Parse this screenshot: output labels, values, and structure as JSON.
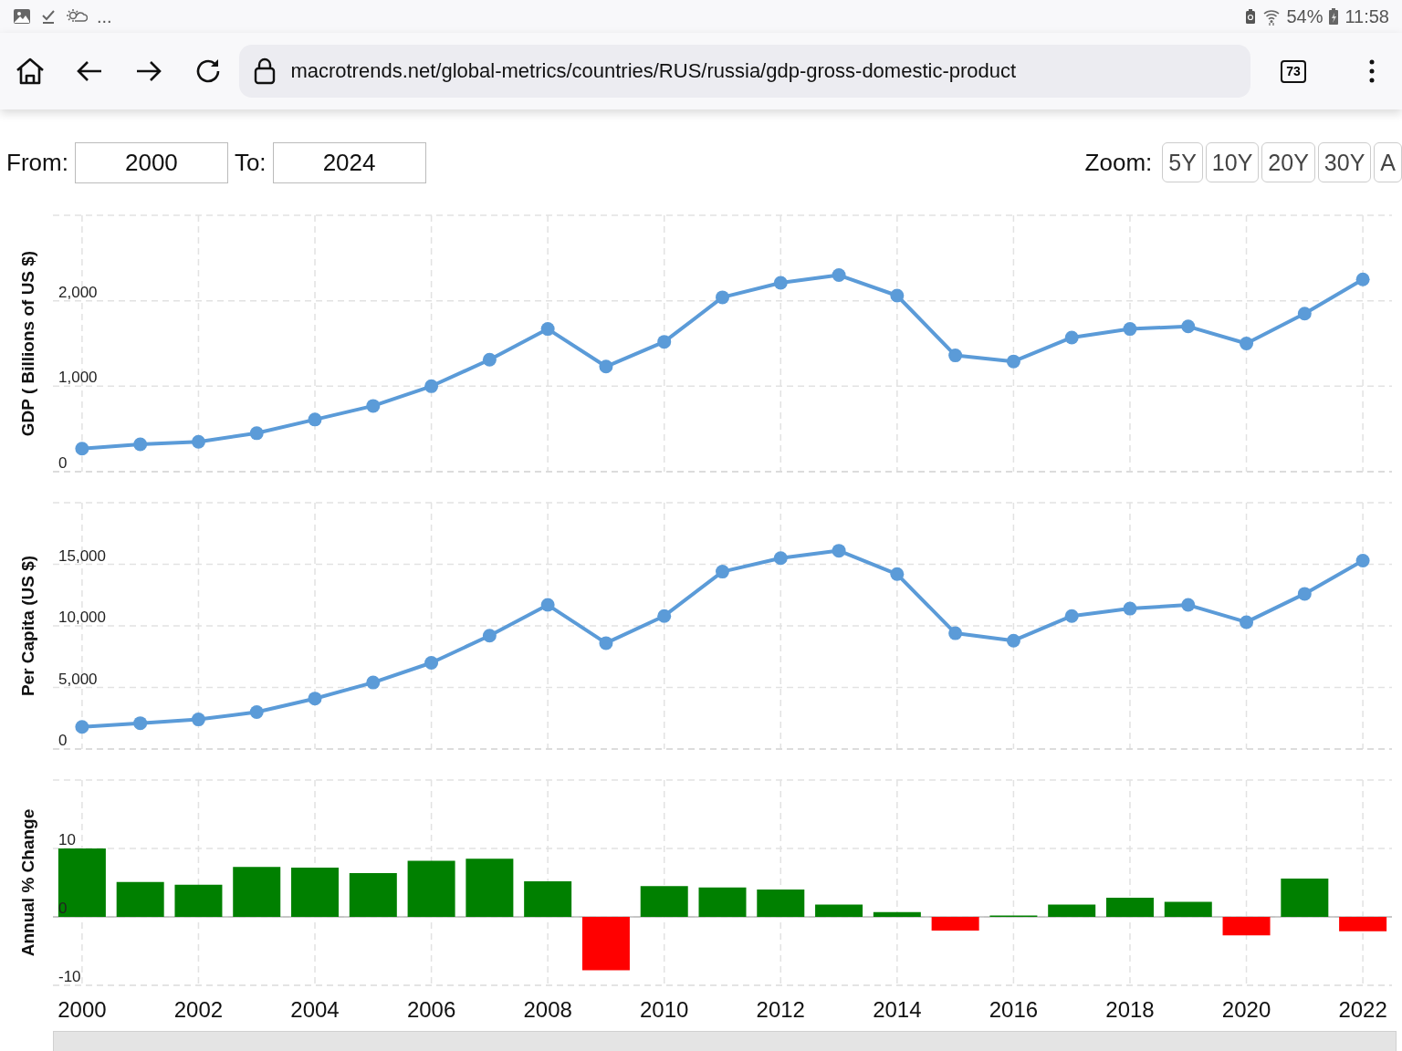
{
  "status_bar": {
    "more": "...",
    "battery": "54%",
    "time": "11:58"
  },
  "browser": {
    "url": "macrotrends.net/global-metrics/countries/RUS/russia/gdp-gross-domestic-product",
    "tab_count": "73"
  },
  "range": {
    "from_label": "From:",
    "from": "2000",
    "to_label": "To:",
    "to": "2024",
    "zoom_label": "Zoom:",
    "zoom_buttons": [
      "5Y",
      "10Y",
      "20Y",
      "30Y",
      "A"
    ]
  },
  "charts": [
    {
      "chart_data": {
        "type": "line",
        "ylabel": "GDP ( Billions of US $)",
        "grid": true,
        "x": [
          2000,
          2001,
          2002,
          2003,
          2004,
          2005,
          2006,
          2007,
          2008,
          2009,
          2010,
          2011,
          2012,
          2013,
          2014,
          2015,
          2016,
          2017,
          2018,
          2019,
          2020,
          2021,
          2022
        ],
        "series": [
          {
            "color": "#5b9bd8",
            "marker": "circle",
            "values": [
              270,
              320,
              350,
              450,
              610,
              770,
              1000,
              1310,
              1670,
              1230,
              1520,
              2040,
              2210,
              2300,
              2060,
              1360,
              1290,
              1570,
              1670,
              1700,
              1500,
              1850,
              2250
            ]
          }
        ],
        "xlim": [
          1999.5,
          2022.5
        ],
        "ylim": [
          0,
          3000
        ],
        "yticks": [
          {
            "value": 0,
            "label": "0"
          },
          {
            "value": 1000,
            "label": "1,000"
          },
          {
            "value": 2000,
            "label": "2,000"
          }
        ]
      }
    },
    {
      "chart_data": {
        "type": "line",
        "ylabel": "Per Capita (US $)",
        "grid": true,
        "x": [
          2000,
          2001,
          2002,
          2003,
          2004,
          2005,
          2006,
          2007,
          2008,
          2009,
          2010,
          2011,
          2012,
          2013,
          2014,
          2015,
          2016,
          2017,
          2018,
          2019,
          2020,
          2021,
          2022
        ],
        "series": [
          {
            "color": "#5b9bd8",
            "marker": "circle",
            "values": [
              1800,
              2100,
              2400,
              3000,
              4100,
              5400,
              7000,
              9200,
              11700,
              8600,
              10800,
              14400,
              15500,
              16100,
              14200,
              9400,
              8800,
              10800,
              11400,
              11700,
              10300,
              12600,
              15300
            ]
          }
        ],
        "xlim": [
          1999.5,
          2022.5
        ],
        "ylim": [
          0,
          20000
        ],
        "yticks": [
          {
            "value": 0,
            "label": "0"
          },
          {
            "value": 5000,
            "label": "5,000"
          },
          {
            "value": 10000,
            "label": "10,000"
          },
          {
            "value": 15000,
            "label": "15,000"
          }
        ]
      }
    },
    {
      "chart_data": {
        "type": "bar",
        "ylabel": "Annual % Change",
        "grid": true,
        "x": [
          2000,
          2001,
          2002,
          2003,
          2004,
          2005,
          2006,
          2007,
          2008,
          2009,
          2010,
          2011,
          2012,
          2013,
          2014,
          2015,
          2016,
          2017,
          2018,
          2019,
          2020,
          2021,
          2022
        ],
        "series": [
          {
            "color": "#008000",
            "values": [
              10.0,
              5.1,
              4.7,
              7.3,
              7.2,
              6.4,
              8.2,
              8.5,
              5.2,
              null,
              4.5,
              4.3,
              4.0,
              1.8,
              0.7,
              null,
              0.2,
              1.8,
              2.8,
              2.2,
              null,
              5.6,
              null
            ]
          },
          {
            "color": "#ff0000",
            "values": [
              null,
              null,
              null,
              null,
              null,
              null,
              null,
              null,
              null,
              -7.8,
              null,
              null,
              null,
              null,
              null,
              -2.0,
              null,
              null,
              null,
              null,
              -2.7,
              null,
              -2.1
            ]
          }
        ],
        "xlim": [
          1999.5,
          2022.5
        ],
        "ylim": [
          -10,
          20
        ],
        "xticks": [
          2000,
          2002,
          2004,
          2006,
          2008,
          2010,
          2012,
          2014,
          2016,
          2018,
          2020,
          2022
        ],
        "yticks": [
          -10,
          0,
          10
        ]
      }
    }
  ]
}
